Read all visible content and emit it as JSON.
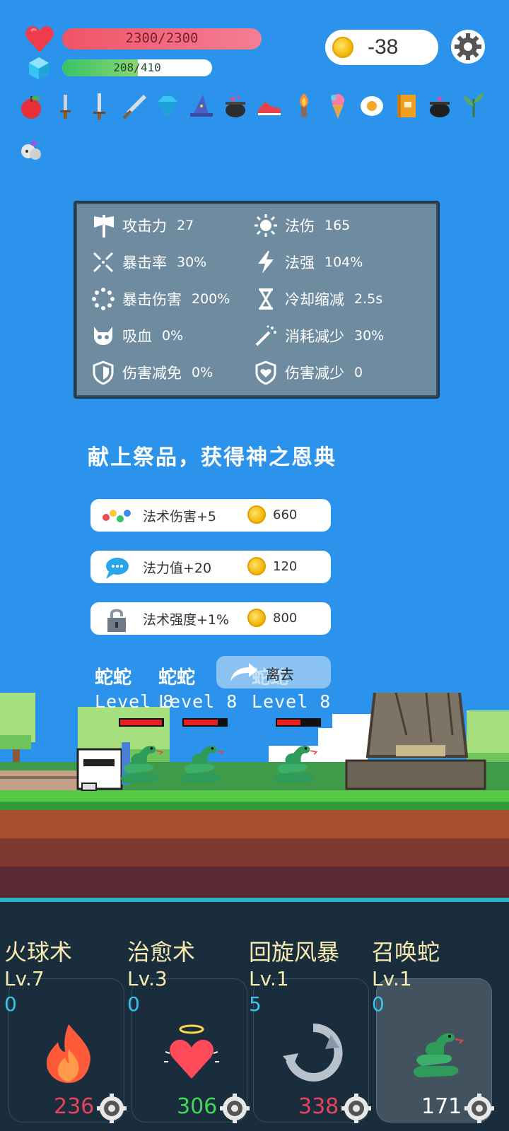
{
  "hud": {
    "hp_text": "2300/2300",
    "hp_fraction": 1.0,
    "mp_text": "208/410",
    "mp_fraction": 0.507,
    "gold": "-38"
  },
  "inventory": [
    "apple-icon",
    "dagger-icon",
    "short-sword-icon",
    "broadsword-icon",
    "diamond-icon",
    "wizard-hat-icon",
    "cauldron-icon",
    "sneaker-icon",
    "torch-icon",
    "ice-cream-icon",
    "fried-egg-icon",
    "spellbook-icon",
    "dark-cauldron-icon",
    "herb-icon",
    "unicorn-icon"
  ],
  "stats": [
    {
      "icon": "axe-icon",
      "label": "攻击力",
      "value": "27"
    },
    {
      "icon": "sun-icon",
      "label": "法伤",
      "value": "165"
    },
    {
      "icon": "crosshair-icon",
      "label": "暴击率",
      "value": "30%"
    },
    {
      "icon": "lightning-icon",
      "label": "法强",
      "value": "104%"
    },
    {
      "icon": "burst-icon",
      "label": "暴击伤害",
      "value": "200%"
    },
    {
      "icon": "hourglass-icon",
      "label": "冷却缩减",
      "value": "2.5s"
    },
    {
      "icon": "skull-icon",
      "label": "吸血",
      "value": "0%"
    },
    {
      "icon": "magic-wand-icon",
      "label": "消耗减少",
      "value": "30%"
    },
    {
      "icon": "shield-icon",
      "label": "伤害减免",
      "value": "0%"
    },
    {
      "icon": "heart-shield-icon",
      "label": "伤害减少",
      "value": "0"
    }
  ],
  "offer_title": "献上祭品，获得神之恩典",
  "offers": [
    {
      "icon": "dots-icon",
      "label": "法术伤害+5",
      "price": "660"
    },
    {
      "icon": "chat-bubble-icon",
      "label": "法力值+20",
      "price": "120"
    },
    {
      "icon": "padlock-icon",
      "label": "法术强度+1%",
      "price": "800"
    }
  ],
  "leave_label": "离去",
  "enemies": [
    {
      "name": "蛇蛇",
      "level": "Level 8",
      "hp": 0.98
    },
    {
      "name": "蛇蛇",
      "level": "Level 8",
      "hp": 0.8
    },
    {
      "name": "蛇蛇",
      "level": "Level 8",
      "hp": 0.55
    }
  ],
  "skills": [
    {
      "name": "火球术",
      "level": "Lv.7",
      "charge": "0",
      "cost": "236",
      "cost_color": "#e8435a",
      "icon": "fire-icon"
    },
    {
      "name": "治愈术",
      "level": "Lv.3",
      "charge": "0",
      "cost": "306",
      "cost_color": "#43d75a",
      "icon": "angel-heart-icon"
    },
    {
      "name": "回旋风暴",
      "level": "Lv.1",
      "charge": "5",
      "cost": "338",
      "cost_color": "#e8435a",
      "icon": "whirlwind-icon"
    },
    {
      "name": "召唤蛇",
      "level": "Lv.1",
      "charge": "0",
      "cost": "171",
      "cost_color": "#ffffff",
      "icon": "snake-icon"
    }
  ]
}
